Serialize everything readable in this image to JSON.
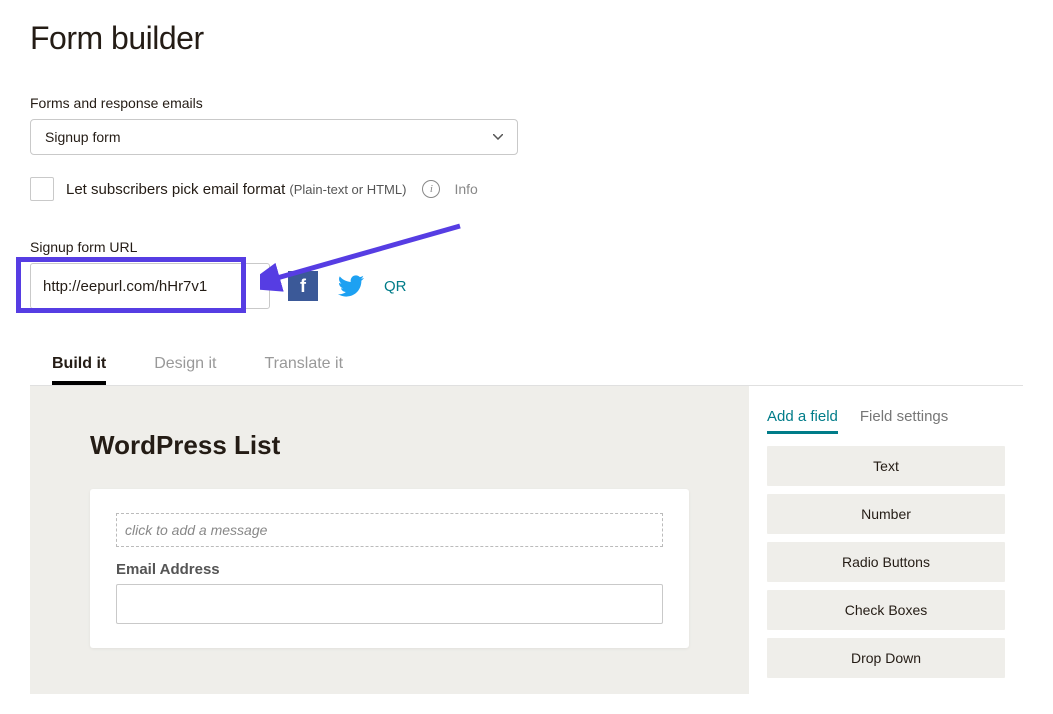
{
  "header": {
    "title": "Form builder"
  },
  "forms": {
    "label": "Forms and response emails",
    "selected": "Signup form"
  },
  "subscriber_format": {
    "label": "Let subscribers pick email format",
    "sublabel": "(Plain-text or HTML)",
    "info_text": "Info"
  },
  "signup_url": {
    "label": "Signup form URL",
    "value": "http://eepurl.com/hHr7v1",
    "qr_label": "QR"
  },
  "tabs": {
    "build": "Build it",
    "design": "Design it",
    "translate": "Translate it"
  },
  "preview": {
    "title": "WordPress List",
    "add_message_placeholder": "click to add a message",
    "email_label": "Email Address"
  },
  "sidebar": {
    "tabs": {
      "add_field": "Add a field",
      "field_settings": "Field settings"
    },
    "fields": [
      "Text",
      "Number",
      "Radio Buttons",
      "Check Boxes",
      "Drop Down"
    ]
  }
}
